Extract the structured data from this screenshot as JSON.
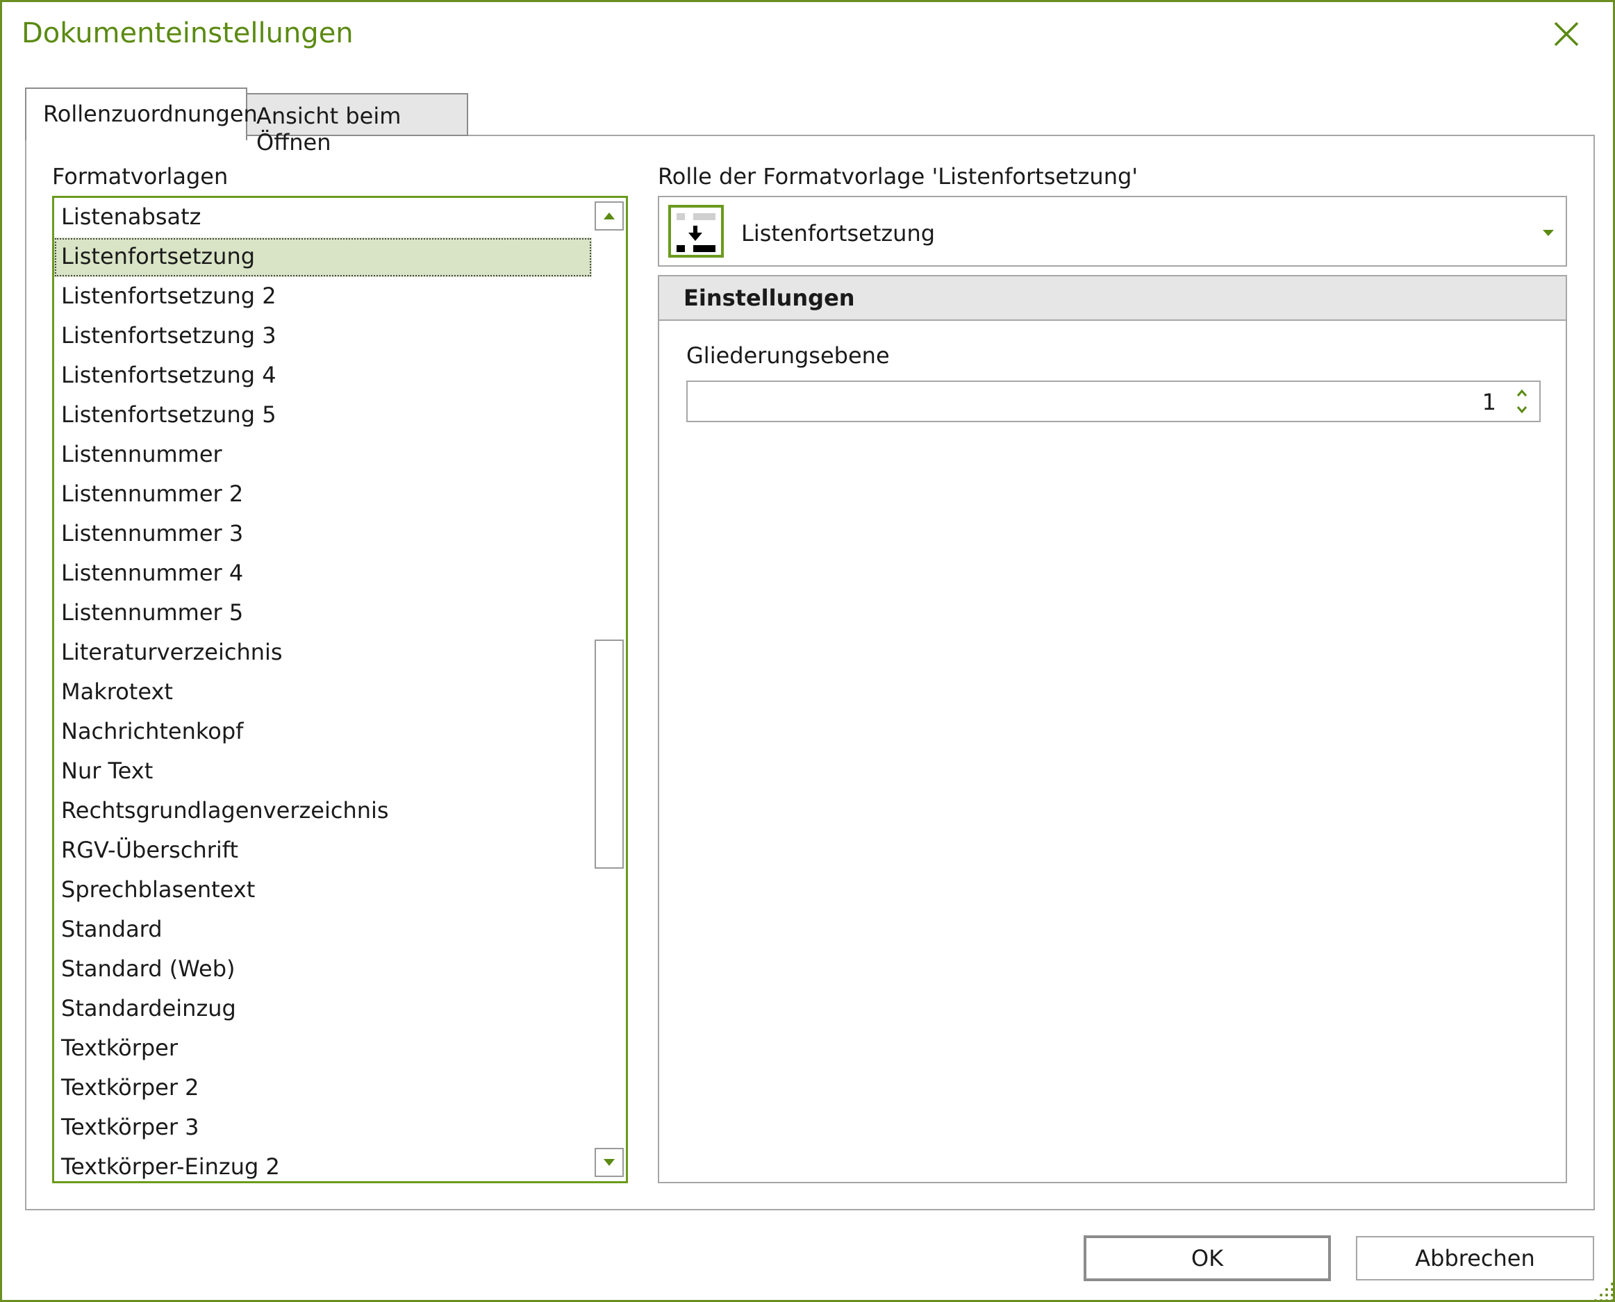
{
  "dialog": {
    "title": "Dokumenteinstellungen",
    "accent_color": "#5b8a12"
  },
  "tabs": [
    {
      "label": "Rollenzuordnungen",
      "active": true
    },
    {
      "label": "Ansicht beim Öffnen",
      "active": false
    }
  ],
  "left_panel": {
    "label": "Formatvorlagen",
    "selected_index": 1,
    "items": [
      "Listenabsatz",
      "Listenfortsetzung",
      "Listenfortsetzung 2",
      "Listenfortsetzung 3",
      "Listenfortsetzung 4",
      "Listenfortsetzung 5",
      "Listennummer",
      "Listennummer 2",
      "Listennummer 3",
      "Listennummer 4",
      "Listennummer 5",
      "Literaturverzeichnis",
      "Makrotext",
      "Nachrichtenkopf",
      "Nur Text",
      "Rechtsgrundlagenverzeichnis",
      "RGV-Überschrift",
      "Sprechblasentext",
      "Standard",
      "Standard (Web)",
      "Standardeinzug",
      "Textkörper",
      "Textkörper 2",
      "Textkörper 3",
      "Textkörper-Einzug 2"
    ]
  },
  "right_panel": {
    "label": "Rolle der Formatvorlage 'Listenfortsetzung'",
    "role_select": {
      "value": "Listenfortsetzung",
      "icon": "list-continuation-icon"
    },
    "settings": {
      "header": "Einstellungen",
      "outline_level": {
        "label": "Gliederungsebene",
        "value": "1"
      }
    }
  },
  "footer": {
    "ok_label": "OK",
    "cancel_label": "Abbrechen"
  }
}
